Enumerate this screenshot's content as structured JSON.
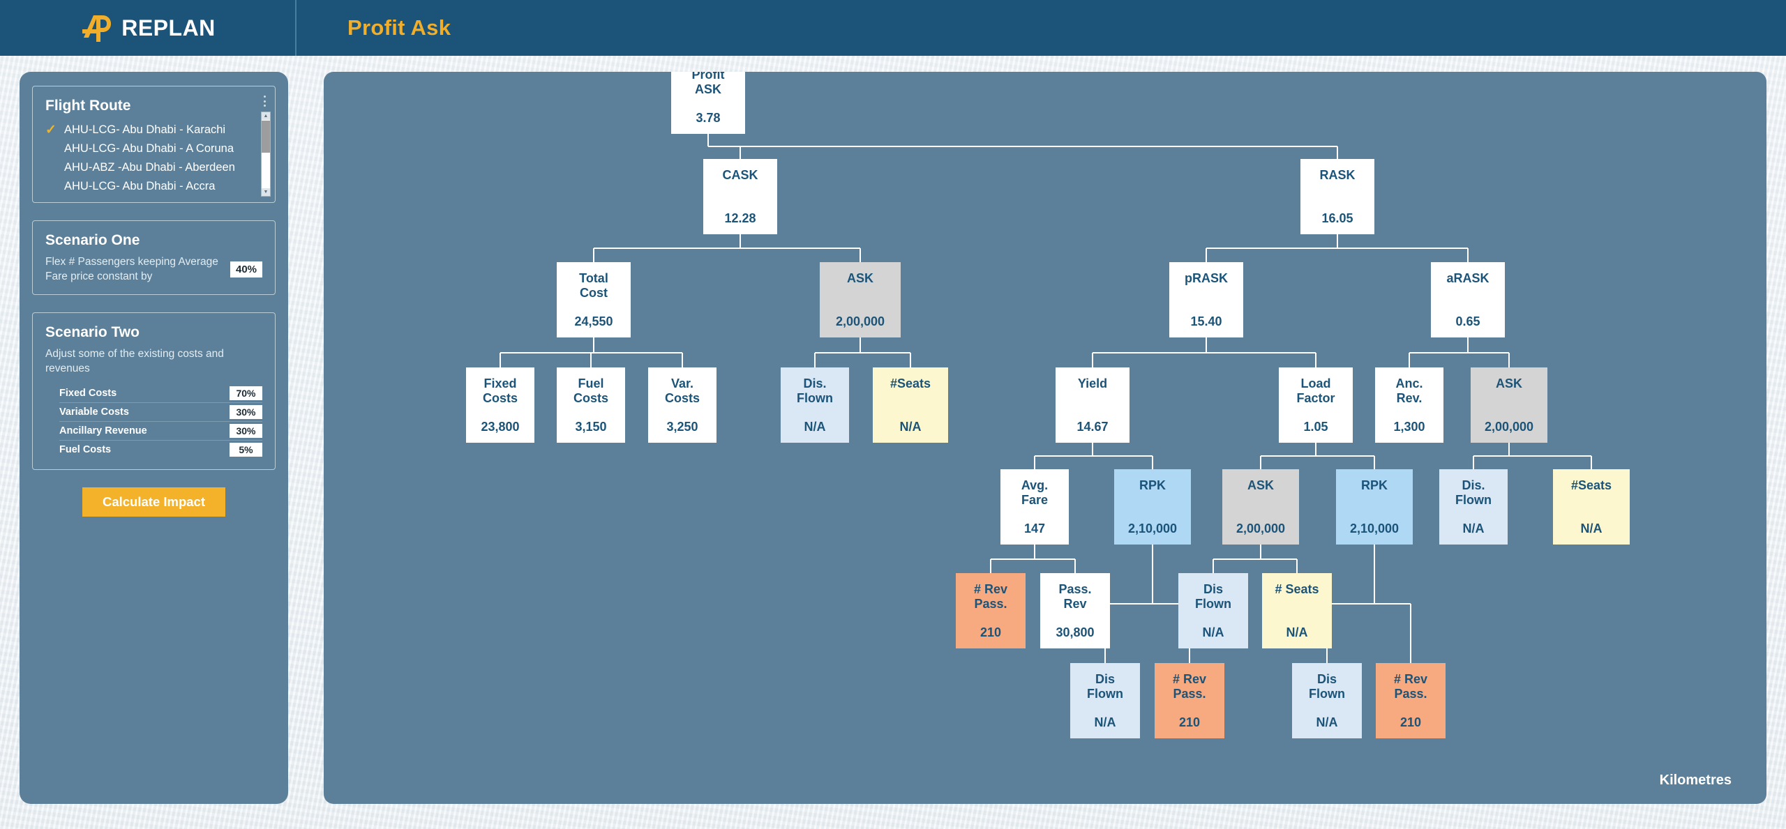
{
  "topbar": {
    "brand_name": "REPLAN",
    "logo_icon": "replan-logo-icon",
    "page_title": "Profit Ask"
  },
  "sidebar": {
    "flight_route": {
      "title": "Flight Route",
      "menu_icon": "kebab-menu-icon",
      "routes": [
        {
          "label": "AHU-LCG- Abu Dhabi - Karachi",
          "selected": true
        },
        {
          "label": "AHU-LCG- Abu Dhabi - A Coruna",
          "selected": false
        },
        {
          "label": "AHU-ABZ -Abu Dhabi - Aberdeen",
          "selected": false
        },
        {
          "label": "AHU-LCG- Abu Dhabi - Accra",
          "selected": false
        }
      ],
      "check_glyph": "✓",
      "scroll_up_glyph": "▲",
      "scroll_down_glyph": "▼"
    },
    "scenario_one": {
      "title": "Scenario One",
      "description": "Flex # Passengers keeping Average Fare price constant by",
      "value": "40%"
    },
    "scenario_two": {
      "title": "Scenario Two",
      "description": "Adjust some of the existing costs and revenues",
      "rows": [
        {
          "label": "Fixed Costs",
          "value": "70%"
        },
        {
          "label": "Variable Costs",
          "value": "30%"
        },
        {
          "label": "Ancillary Revenue",
          "value": "30%"
        },
        {
          "label": "Fuel Costs",
          "value": "5%"
        }
      ]
    },
    "calculate_button": "Calculate Impact"
  },
  "canvas": {
    "footer_label": "Kilometres",
    "colors": {
      "brand_blue": "#1b5478",
      "accent_gold": "#f0ae2b",
      "panel": "#5c8099",
      "node_white": "#ffffff",
      "node_gray": "#d4d4d4",
      "node_blue": "#aed8f4",
      "node_pale": "#dae7f5",
      "node_cream": "#fcf7cf",
      "node_peach": "#f7a980"
    },
    "nodes": [
      {
        "id": "profit-ask",
        "label": "Profit\nASK",
        "value": "3.78",
        "tone": "white"
      },
      {
        "id": "cask",
        "label": "CASK",
        "value": "12.28",
        "tone": "white"
      },
      {
        "id": "rask",
        "label": "RASK",
        "value": "16.05",
        "tone": "white"
      },
      {
        "id": "total-cost",
        "label": "Total\nCost",
        "value": "24,550",
        "tone": "white"
      },
      {
        "id": "ask-1",
        "label": "ASK",
        "value": "2,00,000",
        "tone": "gray"
      },
      {
        "id": "prask",
        "label": "pRASK",
        "value": "15.40",
        "tone": "white"
      },
      {
        "id": "arask",
        "label": "aRASK",
        "value": "0.65",
        "tone": "white"
      },
      {
        "id": "fixed-costs",
        "label": "Fixed\nCosts",
        "value": "23,800",
        "tone": "white"
      },
      {
        "id": "fuel-costs",
        "label": "Fuel\nCosts",
        "value": "3,150",
        "tone": "white"
      },
      {
        "id": "var-costs",
        "label": "Var.\nCosts",
        "value": "3,250",
        "tone": "white"
      },
      {
        "id": "dis-flown-1",
        "label": "Dis.\nFlown",
        "value": "N/A",
        "tone": "pale"
      },
      {
        "id": "seats-1",
        "label": "#Seats",
        "value": "N/A",
        "tone": "cream"
      },
      {
        "id": "yield",
        "label": "Yield",
        "value": "14.67",
        "tone": "white"
      },
      {
        "id": "load-factor",
        "label": "Load\nFactor",
        "value": "1.05",
        "tone": "white"
      },
      {
        "id": "anc-rev",
        "label": "Anc.\nRev.",
        "value": "1,300",
        "tone": "white"
      },
      {
        "id": "ask-2",
        "label": "ASK",
        "value": "2,00,000",
        "tone": "gray"
      },
      {
        "id": "avg-fare",
        "label": "Avg.\nFare",
        "value": "147",
        "tone": "white"
      },
      {
        "id": "rpk-1",
        "label": "RPK",
        "value": "2,10,000",
        "tone": "blue"
      },
      {
        "id": "ask-3",
        "label": "ASK",
        "value": "2,00,000",
        "tone": "gray"
      },
      {
        "id": "rpk-2",
        "label": "RPK",
        "value": "2,10,000",
        "tone": "blue"
      },
      {
        "id": "dis-flown-2",
        "label": "Dis.\nFlown",
        "value": "N/A",
        "tone": "pale"
      },
      {
        "id": "seats-2",
        "label": "#Seats",
        "value": "N/A",
        "tone": "cream"
      },
      {
        "id": "rev-pass-1",
        "label": "# Rev\nPass.",
        "value": "210",
        "tone": "peach"
      },
      {
        "id": "pass-rev",
        "label": "Pass.\nRev",
        "value": "30,800",
        "tone": "white"
      },
      {
        "id": "dis-flown-3",
        "label": "Dis\nFlown",
        "value": "N/A",
        "tone": "pale"
      },
      {
        "id": "seats-3",
        "label": "# Seats",
        "value": "N/A",
        "tone": "cream"
      },
      {
        "id": "dis-flown-4",
        "label": "Dis\nFlown",
        "value": "N/A",
        "tone": "pale"
      },
      {
        "id": "rev-pass-2",
        "label": "# Rev\nPass.",
        "value": "210",
        "tone": "peach"
      },
      {
        "id": "dis-flown-5",
        "label": "Dis\nFlown",
        "value": "N/A",
        "tone": "pale"
      },
      {
        "id": "rev-pass-3",
        "label": "# Rev\nPass.",
        "value": "210",
        "tone": "peach"
      }
    ]
  },
  "chart_data": {
    "type": "diagram-tree",
    "title": "Profit Ask",
    "root": "Profit ASK = 3.78",
    "edges": [
      [
        "profit-ask",
        "cask"
      ],
      [
        "profit-ask",
        "rask"
      ],
      [
        "cask",
        "total-cost"
      ],
      [
        "cask",
        "ask-1"
      ],
      [
        "total-cost",
        "fixed-costs"
      ],
      [
        "total-cost",
        "fuel-costs"
      ],
      [
        "total-cost",
        "var-costs"
      ],
      [
        "ask-1",
        "dis-flown-1"
      ],
      [
        "ask-1",
        "seats-1"
      ],
      [
        "rask",
        "prask"
      ],
      [
        "rask",
        "arask"
      ],
      [
        "prask",
        "yield"
      ],
      [
        "prask",
        "load-factor"
      ],
      [
        "arask",
        "anc-rev"
      ],
      [
        "arask",
        "ask-2"
      ],
      [
        "yield",
        "avg-fare"
      ],
      [
        "yield",
        "rpk-1"
      ],
      [
        "load-factor",
        "ask-3"
      ],
      [
        "load-factor",
        "rpk-2"
      ],
      [
        "ask-2",
        "dis-flown-2"
      ],
      [
        "ask-2",
        "seats-2"
      ],
      [
        "avg-fare",
        "rev-pass-1"
      ],
      [
        "avg-fare",
        "pass-rev"
      ],
      [
        "ask-3",
        "dis-flown-3"
      ],
      [
        "ask-3",
        "seats-3"
      ],
      [
        "rpk-1",
        "dis-flown-4"
      ],
      [
        "rpk-1",
        "rev-pass-2"
      ],
      [
        "rpk-2",
        "dis-flown-5"
      ],
      [
        "rpk-2",
        "rev-pass-3"
      ]
    ],
    "values": {
      "Profit ASK": 3.78,
      "CASK": 12.28,
      "RASK": 16.05,
      "Total Cost": 24550,
      "ASK": 200000,
      "pRASK": 15.4,
      "aRASK": 0.65,
      "Fixed Costs": 23800,
      "Fuel Costs": 3150,
      "Var. Costs": 3250,
      "Yield": 14.67,
      "Load Factor": 1.05,
      "Anc. Rev.": 1300,
      "Avg. Fare": 147,
      "RPK": 210000,
      "# Rev Pass.": 210,
      "Pass. Rev": 30800
    },
    "units": "Kilometres"
  }
}
